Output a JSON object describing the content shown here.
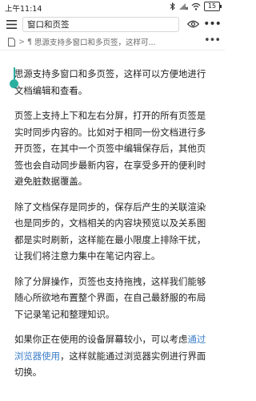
{
  "status_bar": {
    "time": "上午11:14",
    "battery": "15"
  },
  "toolbar": {
    "doc_title": "窗口和页签"
  },
  "breadcrumb": {
    "separator": ">",
    "paragraph_mark": "¶",
    "text": "思源支持多窗口和多页签，这样可..."
  },
  "content": {
    "p1": "思源支持多窗口和多页签，这样可以方便地进行文档编辑和查看。",
    "p2": "页签上支持上下和左右分屏，打开的所有页签是实时同步内容的。比如对于相同一份文档进行多开页签，在其中一个页签中编辑保存后，其他页签也会自动同步最新内容，在享受多开的便利时避免脏数据覆盖。",
    "p3": "除了文档保存是同步的，保存后产生的关联渲染也是同步的，文档相关的内容块预览以及关系图都是实时刷新，这样能在最小限度上排除干扰，让我们将注意力集中在笔记内容上。",
    "p4": "除了分屏操作，页签也支持拖拽，这样我们能够随心所欲地布置整个界面，在自己最舒服的布局下记录笔记和整理知识。",
    "p5_before": "如果你正在使用的设备屏幕较小，可以考虑",
    "p5_link": "通过浏览器使用",
    "p5_after": "，这样就能通过浏览器实例进行界面切换。"
  },
  "colors": {
    "link": "#3a7ec9",
    "cursor": "#2bb0a0"
  }
}
